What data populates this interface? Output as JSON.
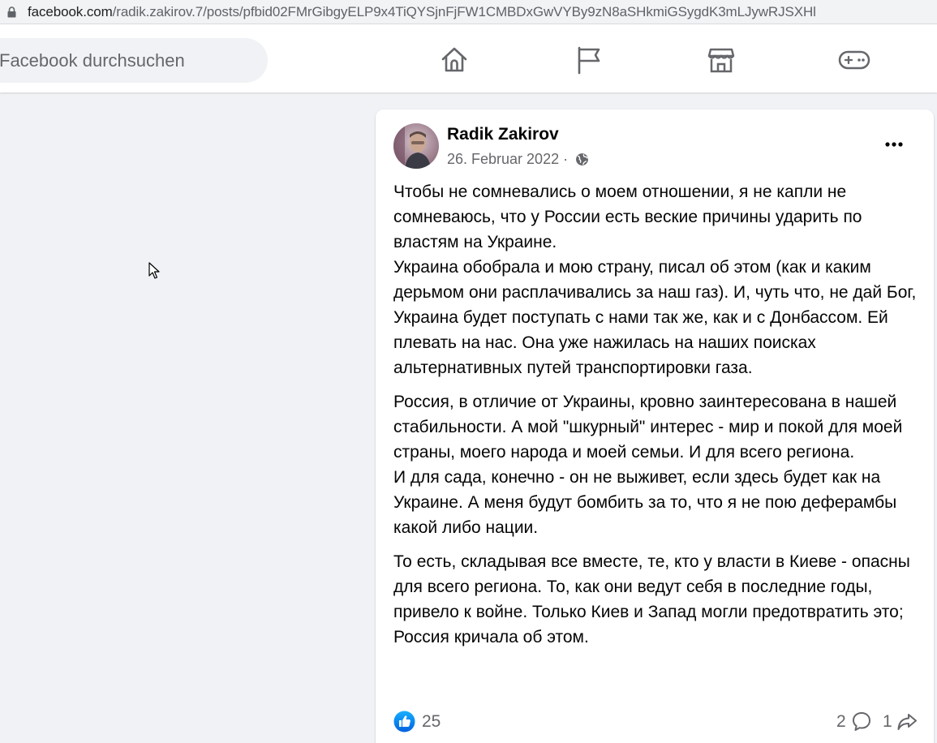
{
  "browser": {
    "url_host": "facebook.com",
    "url_path": "/radik.zakirov.7/posts/pfbid02FMrGibgyELP9x4TiQYSjnFjFW1CMBDxGwVYBy9zN8aSHkmiGSygdK3mLJywRJSXHl"
  },
  "header": {
    "search_placeholder": "Facebook durchsuchen",
    "nav_icons": [
      "home-icon",
      "pages-flag-icon",
      "marketplace-icon",
      "gaming-icon"
    ]
  },
  "post": {
    "author": "Radik Zakirov",
    "date": "26. Februar 2022",
    "separator": " · ",
    "privacy_icon": "globe-icon",
    "paragraphs": [
      "Чтобы не сомневались о моем отношении, я не капли не сомневаюсь, что у России есть веские причины ударить по властям на Украине.\nУкраина обобрала и мою страну, писал об этом (как и каким дерьмом они расплачивались за наш газ).  И, чуть что, не дай Бог, Украина будет поступать с нами так же, как и с Донбассом.  Ей плевать на нас.  Она уже нажилась на наших поисках альтернативных путей транспортировки газа.",
      "Россия, в отличие от Украины, кровно заинтересована в нашей стабильности.  А мой \"шкурный\" интерес - мир и покой для моей страны, моего народа и моей семьи.  И для всего региона.\nИ для сада, конечно - он не выживет, если здесь будет как на Украине.  А меня будут бомбить за то, что я не пою деферамбы какой либо нации.",
      "То есть, складывая все вместе, те, кто у власти в Киеве - опасны для всего региона.  То, как они ведут себя в последние годы, привело к войне.  Только Киев и Запад могли предотвратить это; Россия кричала об этом."
    ],
    "reactions_count": "25",
    "comments_count": "2",
    "shares_count": "1"
  },
  "colors": {
    "facebook_blue": "#1877f2",
    "secondary_text": "#65676b",
    "page_bg": "#f0f2f5"
  }
}
